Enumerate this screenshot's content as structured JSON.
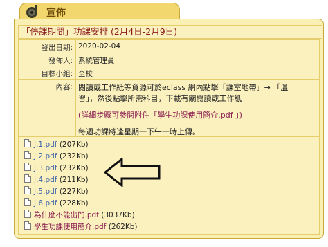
{
  "tab": {
    "title": "宣佈",
    "icon": "speaker-icon"
  },
  "announcement": {
    "heading": "「停課期間」功課安排 (2月4日-2月9日)",
    "rows": [
      {
        "label": "發出日期:",
        "value": "2020-02-04"
      },
      {
        "label": "發佈人:",
        "value": "系統管理員"
      },
      {
        "label": "目標小組:",
        "value": "全校"
      }
    ],
    "content_label": "內容:",
    "content": {
      "line1": "閱讀或工作紙等資源可於eclass 網內點擊「課室地帶」→ 「溫",
      "line2": "習」，然後點擊所需科目，下載有關閱讀或工作紙",
      "line3_prefix": "(詳細步驟可參閱附件「",
      "line3_link": "學生功課使用簡介.pdf",
      "line3_suffix": " 」)",
      "line4": "每週功課將逢星期一下午一時上傳。"
    }
  },
  "attachments": [
    {
      "name": "J.1.pdf",
      "size": "(207Kb)"
    },
    {
      "name": "J.2.pdf",
      "size": "(232Kb)"
    },
    {
      "name": "J.3.pdf",
      "size": "(232Kb)"
    },
    {
      "name": "J.4.pdf",
      "size": "(211Kb)"
    },
    {
      "name": "J.5.pdf",
      "size": "(227Kb)"
    },
    {
      "name": "J.6.pdf",
      "size": "(228Kb)"
    },
    {
      "name": "為什麼不能出門.pdf",
      "size": "(3037Kb)"
    },
    {
      "name": "學生功課使用簡介.pdf",
      "size": "(262Kb)"
    }
  ],
  "arrow_icon": "left-arrow-icon",
  "colors": {
    "panel_bg": "#faf0b4",
    "tab_bg": "#f1d76e",
    "heading_text": "#8a1a1a",
    "link": "#3a62a8"
  }
}
